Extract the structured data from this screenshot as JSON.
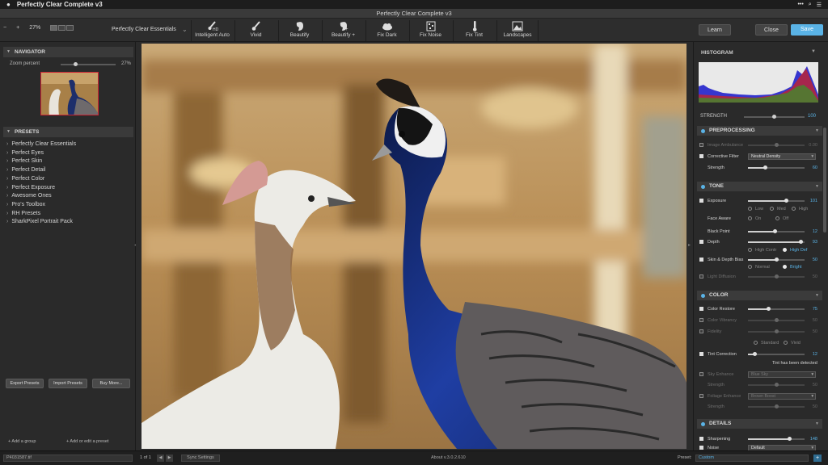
{
  "menubar": {
    "app_name": "Perfectly Clear Complete v3"
  },
  "window": {
    "title": "Perfectly Clear Complete v3"
  },
  "toolbar": {
    "zoom_minus": "−",
    "zoom_plus": "+",
    "zoom_value": "27%",
    "preset_name": "Perfectly Clear Essentials",
    "tools": [
      {
        "label": "Intelligent Auto",
        "icon": "brush-hd-icon"
      },
      {
        "label": "Vivid",
        "icon": "brush-icon"
      },
      {
        "label": "Beautify",
        "icon": "face-icon"
      },
      {
        "label": "Beautify +",
        "icon": "face-plus-icon"
      },
      {
        "label": "Fix Dark",
        "icon": "cloud-icon"
      },
      {
        "label": "Fix Noise",
        "icon": "noise-icon"
      },
      {
        "label": "Fix Tint",
        "icon": "thermometer-icon"
      },
      {
        "label": "Landscapes",
        "icon": "landscape-icon"
      }
    ],
    "learn_label": "Learn",
    "close_label": "Close",
    "save_label": "Save",
    "accent": "#5ab3e6"
  },
  "navigator": {
    "title": "NAVIGATOR",
    "zoom_label": "Zoom percent",
    "zoom_value": "27%",
    "zoom_fraction": 0.27
  },
  "presets": {
    "title": "PRESETS",
    "items": [
      "Perfectly Clear Essentials",
      "Perfect Eyes",
      "Perfect Skin",
      "Perfect Detail",
      "Perfect Color",
      "Perfect Exposure",
      "Awesome Ones",
      "Pro's Toolbox",
      "RH Presets",
      "SharkPixel Portrait Pack"
    ],
    "export_label": "Export Presets",
    "import_label": "Import Presets",
    "buy_label": "Buy More...",
    "add_group_label": "+ Add a group",
    "add_preset_label": "+ Add or edit a preset"
  },
  "histogram": {
    "title": "HISTOGRAM"
  },
  "strength": {
    "label": "STRENGTH",
    "value": "100",
    "fraction": 1.0
  },
  "preprocessing": {
    "title": "PREPROCESSING",
    "image_ambulance": {
      "label": "Image Ambulance",
      "value": "0.00",
      "fraction": 0.5
    },
    "corrective_filter": {
      "label": "Corrective Filter",
      "option": "Neutral Density"
    },
    "strength": {
      "label": "Strength",
      "value": "60",
      "fraction": 0.3
    }
  },
  "tone": {
    "title": "TONE",
    "exposure": {
      "label": "Exposure",
      "value": "101",
      "fraction": 0.68
    },
    "exposure_opts": [
      "Low",
      "Med",
      "High"
    ],
    "face_aware": {
      "label": "Face Aware",
      "opts": [
        "On",
        "Off"
      ]
    },
    "black_point": {
      "label": "Black Point",
      "value": "12",
      "fraction": 0.48
    },
    "depth": {
      "label": "Depth",
      "value": "93",
      "fraction": 0.93
    },
    "depth_opts": [
      "High Contr",
      "High Def"
    ],
    "skin_depth": {
      "label": "Skin & Depth Bias",
      "value": "50",
      "fraction": 0.5
    },
    "skin_opts": [
      "Normal",
      "Bright"
    ],
    "light_diffusion": {
      "label": "Light Diffusion",
      "value": "50",
      "fraction": 0.5
    }
  },
  "color": {
    "title": "COLOR",
    "color_restore": {
      "label": "Color Restore",
      "value": "75",
      "fraction": 0.37
    },
    "color_vibrancy": {
      "label": "Color Vibrancy",
      "value": "50",
      "fraction": 0.5
    },
    "fidelity": {
      "label": "Fidelity",
      "value": "50",
      "fraction": 0.5
    },
    "fidelity_opts": [
      "Standard",
      "Vivid"
    ],
    "tint_correction": {
      "label": "Tint Correction",
      "value": "12",
      "fraction": 0.12
    },
    "tint_detected": "Tint has been detected",
    "sky_enhance": {
      "label": "Sky Enhance",
      "option": "Blue Sky"
    },
    "sky_strength": {
      "label": "Strength",
      "value": "50",
      "fraction": 0.5
    },
    "foliage_enhance": {
      "label": "Foliage Enhance",
      "option": "Brown Boost"
    },
    "foliage_strength": {
      "label": "Strength",
      "value": "50",
      "fraction": 0.5
    }
  },
  "details": {
    "title": "DETAILS",
    "sharpening": {
      "label": "Sharpening",
      "value": "148",
      "fraction": 0.74
    },
    "noise": {
      "label": "Noise",
      "option": "Default"
    }
  },
  "statusbar": {
    "filename": "P4031587.tif",
    "page": "1 of 1",
    "sync_label": "Sync Settings",
    "version": "About v.3.0.2.610",
    "preset_label": "Preset:",
    "preset_value": "Custom"
  }
}
